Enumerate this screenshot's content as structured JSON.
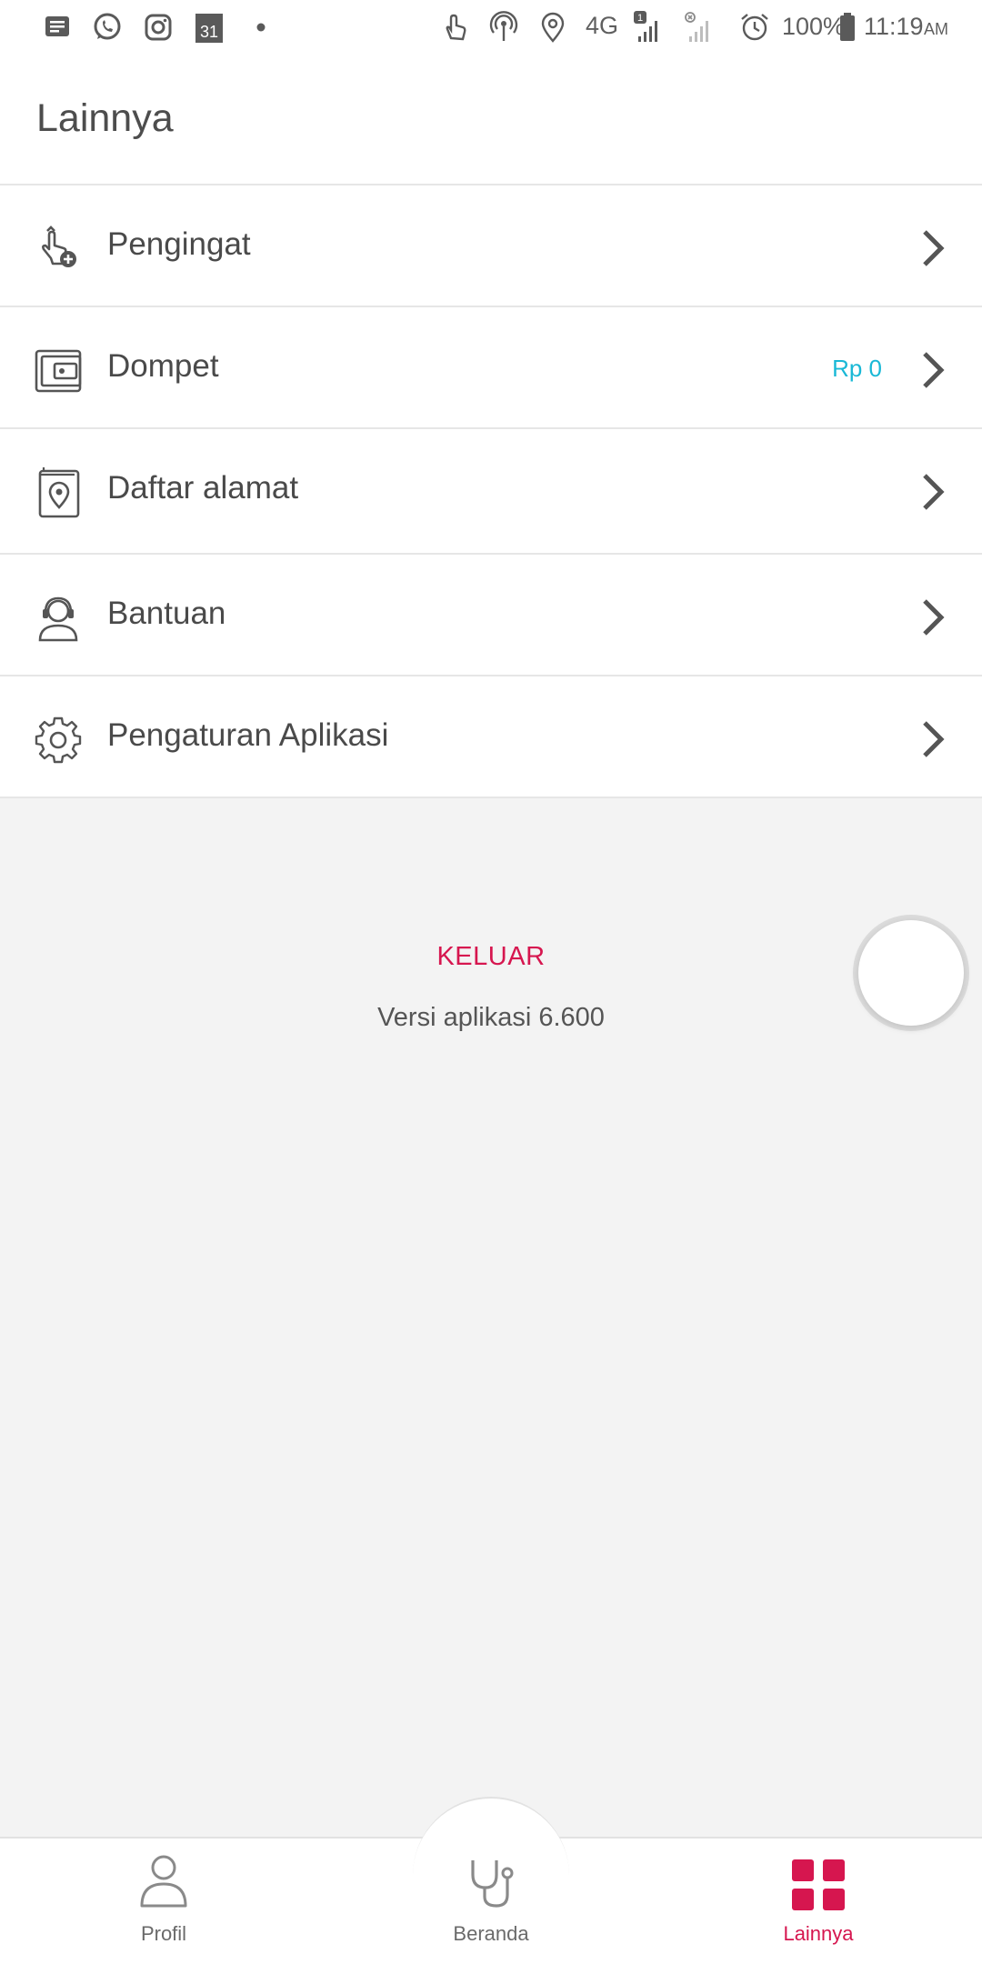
{
  "status_bar": {
    "battery": "100%",
    "time": "11:19",
    "ampm": "AM",
    "network": "4G",
    "sim_badge": "1",
    "calendar_day": "31"
  },
  "appbar": {
    "title": "Lainnya"
  },
  "menu": {
    "items": [
      {
        "label": "Pengingat",
        "icon": "reminder-hand-icon"
      },
      {
        "label": "Dompet",
        "icon": "wallet-icon",
        "value": "Rp 0"
      },
      {
        "label": "Daftar alamat",
        "icon": "address-book-icon"
      },
      {
        "label": "Bantuan",
        "icon": "support-agent-icon"
      },
      {
        "label": "Pengaturan Aplikasi",
        "icon": "gear-icon"
      }
    ]
  },
  "logout_label": "KELUAR",
  "version_text": "Versi aplikasi 6.600",
  "bottom_nav": {
    "items": [
      {
        "label": "Profil",
        "icon": "person-icon"
      },
      {
        "label": "Beranda",
        "icon": "stethoscope-icon"
      },
      {
        "label": "Lainnya",
        "icon": "grid-icon",
        "active": true
      }
    ]
  },
  "colors": {
    "accent": "#d6164f",
    "link": "#19b8d6",
    "text": "#4a4a4a",
    "background": "#f3f3f3"
  }
}
